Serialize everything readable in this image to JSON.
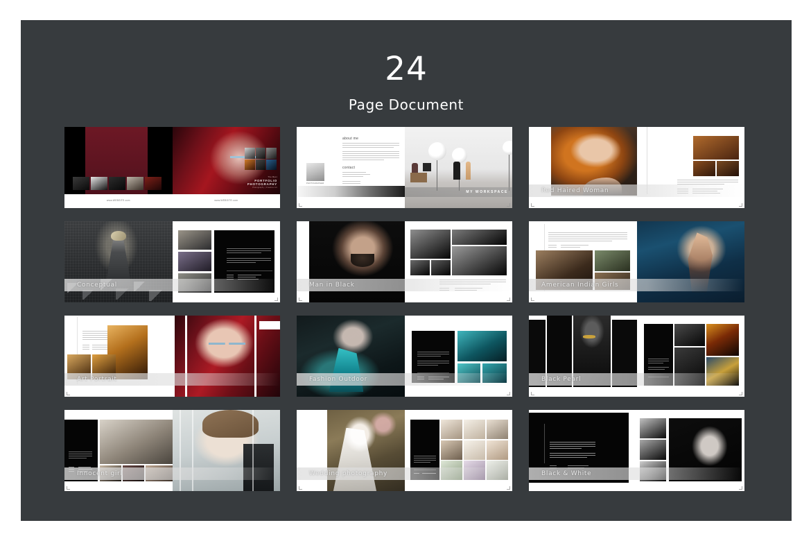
{
  "header": {
    "count": "24",
    "subtitle": "Page Document"
  },
  "colors": {
    "panel_background": "#373b3e",
    "page_background": "#ffffff",
    "caption_text": "#e9e9e9",
    "cover_maroon": "#6d1825",
    "heading_text": "#ffffff"
  },
  "cover": {
    "title": "PORTFOLIO PHOTOGRAPHY",
    "pretitle": "The Best",
    "subtitle": "Photography | Creative Art",
    "footer_url_left": "www.WEBSITE.com",
    "footer_url_right": "www.WEBSITE.com"
  },
  "about_page": {
    "heading_about": "about me",
    "heading_contact": "contact",
    "signature_label": "PHOTOGRAPHER",
    "email_line": "Email :  janedoe@yourmail.com",
    "workspace_label": "MY WORKSPACE"
  },
  "spreads": [
    {
      "index": 1,
      "caption": "",
      "name": "cover-spread"
    },
    {
      "index": 2,
      "caption": "",
      "name": "about-me-spread"
    },
    {
      "index": 3,
      "caption": "Red Haired Woman",
      "name": "red-haired-woman-spread"
    },
    {
      "index": 4,
      "caption": "Conceptual",
      "name": "conceptual-spread"
    },
    {
      "index": 5,
      "caption": "Man in Black",
      "name": "man-in-black-spread"
    },
    {
      "index": 6,
      "caption": "American Indian Girls",
      "name": "american-indian-girls-spread"
    },
    {
      "index": 7,
      "caption": "Art Portrait",
      "name": "art-portrait-spread"
    },
    {
      "index": 8,
      "caption": "Fashion Outdoor",
      "name": "fashion-outdoor-spread"
    },
    {
      "index": 9,
      "caption": "Black Pearl",
      "name": "black-pearl-spread"
    },
    {
      "index": 10,
      "caption": "Innocent girl",
      "name": "innocent-girl-spread"
    },
    {
      "index": 11,
      "caption": "Wedding photography",
      "name": "wedding-photography-spread"
    },
    {
      "index": 12,
      "caption": "Black & White",
      "name": "black-and-white-spread"
    }
  ],
  "grid": {
    "columns": 3,
    "rows": 4,
    "total_spreads": 12
  }
}
